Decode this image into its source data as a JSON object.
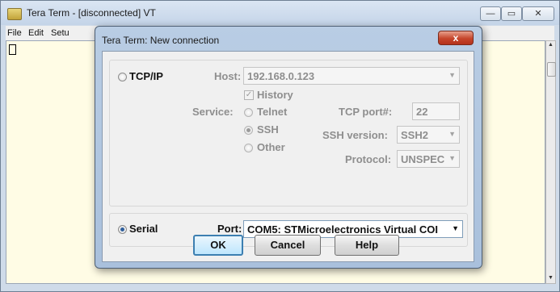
{
  "main_window": {
    "title": "Tera Term - [disconnected] VT",
    "controls": {
      "minimize": "—",
      "restore": "▭",
      "close": "✕"
    },
    "menu": [
      "File",
      "Edit",
      "Setu"
    ]
  },
  "dialog": {
    "title": "Tera Term: New connection",
    "close_glyph": "x",
    "tcpip": {
      "radio_label": "TCP/IP",
      "selected": false,
      "host_label": "Host:",
      "host_value": "192.168.0.123",
      "history_label": "History",
      "history_checked": true,
      "service_label": "Service:",
      "services": [
        "Telnet",
        "SSH",
        "Other"
      ],
      "service_selected": "SSH",
      "tcp_port_label": "TCP port#:",
      "tcp_port_value": "22",
      "ssh_version_label": "SSH version:",
      "ssh_version_value": "SSH2",
      "protocol_label": "Protocol:",
      "protocol_value": "UNSPEC"
    },
    "serial": {
      "radio_label": "Serial",
      "selected": true,
      "port_label": "Port:",
      "port_value": "COM5: STMicroelectronics Virtual COI"
    },
    "buttons": {
      "ok": "OK",
      "cancel": "Cancel",
      "help": "Help"
    }
  },
  "icons": {
    "app_icon": "tera-term-icon",
    "dropdown": "chevron-down-icon",
    "check": "checkmark-icon",
    "scroll_up": "▲",
    "scroll_down": "▼"
  },
  "colors": {
    "title_bar": "#c4d4e8",
    "close_button": "#c5452b",
    "terminal_bg": "#fffce5",
    "disabled_text": "#8e8e8e",
    "focus_border": "#3c7fb1"
  }
}
